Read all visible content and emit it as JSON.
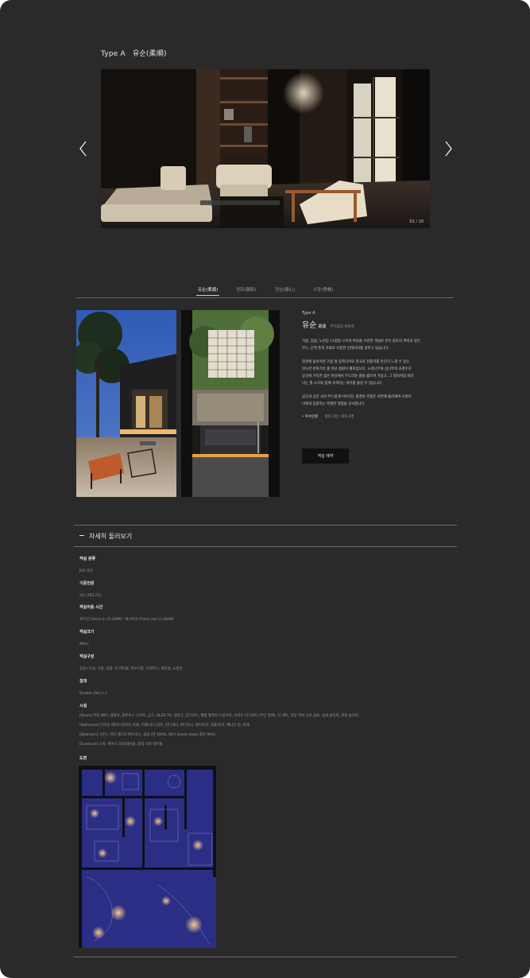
{
  "header": {
    "type_label": "Type A",
    "room_name": "유순(柔順)"
  },
  "hero": {
    "counter": "01 / 10"
  },
  "tabs": [
    {
      "label": "유순(柔順)",
      "active": true
    },
    {
      "label": "정화(靜和)",
      "active": false
    },
    {
      "label": "정심(靜心)",
      "active": false
    },
    {
      "label": "수창(秀暢)",
      "active": false
    }
  ],
  "room_info": {
    "type_tag": "Type A",
    "name": "유순",
    "hanja": "柔順",
    "short_desc": "부드럽고 온화하",
    "para1": "거실, 침실, 노천탕 11평형 구조와 마당을 수반한 객실로 한지 창호의 맥락과 깊은\n무드, 간색 톤의 조화로 차분한 인테리어를 갖추고 있습니다.",
    "para2": "현관에 들어서면 거실 앞 동쪽너머로 한국의 전통미를 온전히 느낄 수 있는\n아늑한 분위기의 홀 마당 정원이 펼쳐집니다. 노천나무와 삼나무의 조경수가\n곳곳에 가득한 넓은 마당에서 부드러운 흙을 밟으며 거닐고, 그 평자처럼 따라\n나는 흙 소리와 함께 사색하는 여유를 즐길 수 있습니다.",
    "para3": "공간과 공간 사이 부드럽게 이어지는 풍경의 흐름은 자연에 둘러싸여 오롯이\n나에게 집중하는 특별한 경험을 선사합니다.",
    "occupancy_label": "투숙인원",
    "occupancy_value": "정원 2명 / 최대 2명",
    "reserve_button": "객실 예약"
  },
  "details": {
    "toggle_label": "자세히 둘러보기",
    "specs": [
      {
        "title": "객실 분류",
        "lines": [
          "JOA 유순"
        ]
      },
      {
        "title": "기준인원",
        "lines": [
          "2인 (최대 2인)"
        ]
      },
      {
        "title": "객실이용 시간",
        "lines": [
          "체크인 Check-in 15:00PM / 체크아웃 Check-out 11:00AM"
        ]
      },
      {
        "title": "객실크기",
        "lines": [
          "99m²"
        ]
      },
      {
        "title": "객실구성",
        "lines": [
          "침실+다실, 거실, 응접, 티 테이블, 파우더룸, 샤워부스, 화장실, 노천탕"
        ]
      },
      {
        "title": "침대",
        "lines": [
          "Double (Gk) x 1"
        ]
      },
      {
        "title": "시설",
        "lines": [
          "[Room] 무료 WiFi, 샘플북, 블루투스 스피커, 금고, QLED TV, 냉장고, 전기포트, 웰컴 웰케인 드립커피, 오리도 티기세트 (무인 업체), 차 세트, 옷장 착의 오로 음료, 실내 슬리퍼, 쿤데 슬리퍼",
          "[Bathroom] 다이슨 헤어드라이어, 타올, 어메니티 (샴푸, 컨디셔너, 바디워시, 바디로션, 칫솔/치약, 빼니티 킷, 비데",
          "[Bedroom] 시몬스 뷰티 레스트 매트리스, 침대 (면 100%, 80's Goose down 충진 90%)",
          "[Furniture] 소파, 체아스 의자/테이블, 창덕 의자 테이블"
        ]
      }
    ],
    "floorplan_label": "도면"
  },
  "colors": {
    "background": "#2a2a2a",
    "floorplan_blue": "#2c2e86",
    "button_bg": "#111111"
  }
}
